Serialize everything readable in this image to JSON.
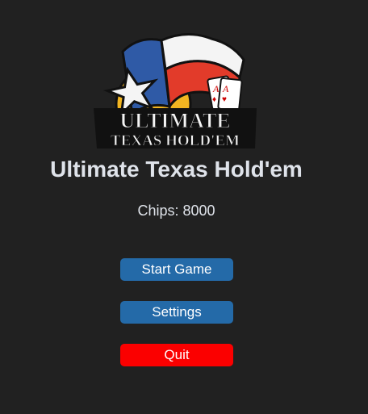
{
  "logo": {
    "line1": "ULTIMATE",
    "line2": "TEXAS HOLD'EM",
    "card1": "A",
    "card2": "A",
    "colors": {
      "flag_blue": "#2f5aa6",
      "flag_red": "#e23b2a",
      "flag_white": "#f4f4f4",
      "gold": "#f2b521",
      "outline": "#111111"
    },
    "icons": [
      "star-icon",
      "texas-flag-icon",
      "playing-card-icon"
    ]
  },
  "title": "Ultimate Texas Hold'em",
  "chips_text": "Chips: 8000",
  "menu": {
    "start_label": "Start Game",
    "settings_label": "Settings",
    "quit_label": "Quit"
  },
  "colors": {
    "background": "#212121",
    "text": "#dfe3ea",
    "button_blue": "#246aa8",
    "button_red": "#fb0000"
  }
}
